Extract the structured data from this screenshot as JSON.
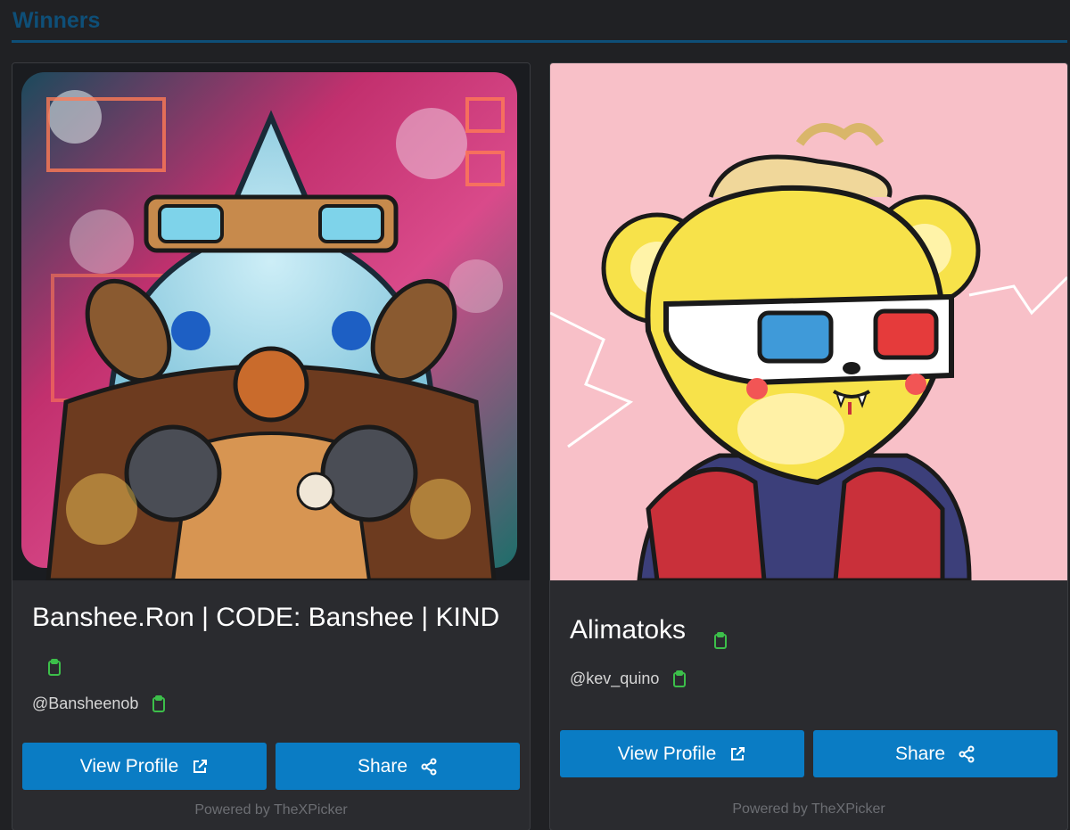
{
  "section": {
    "title": "Winners"
  },
  "winners": [
    {
      "name": "Banshee.Ron | CODE: Banshee | KIND",
      "handle": "@Bansheenob",
      "view_label": "View Profile",
      "share_label": "Share",
      "powered_by": "Powered by TheXPicker",
      "image": "cyberpunk-robot-nft"
    },
    {
      "name": "Alimatoks",
      "handle": "@kev_quino",
      "view_label": "View Profile",
      "share_label": "Share",
      "powered_by": "Powered by TheXPicker",
      "image": "yellow-bear-3d-glasses-nft"
    }
  ],
  "colors": {
    "background": "#202124",
    "card": "#2a2b2f",
    "accent": "#0a7cc4",
    "title": "#0e4f78",
    "copy_icon": "#3cbf4a"
  },
  "icons": {
    "copy": "clipboard-icon",
    "external": "external-link-icon",
    "share": "share-icon"
  }
}
